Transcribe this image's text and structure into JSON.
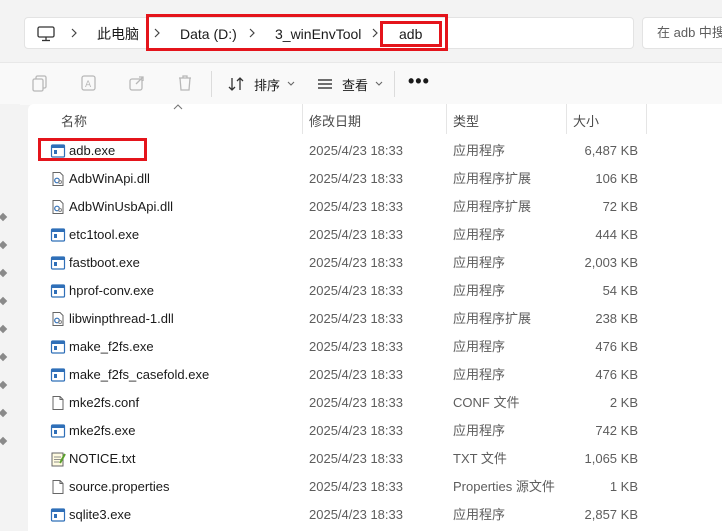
{
  "breadcrumb": {
    "items": [
      "此电脑",
      "Data (D:)",
      "3_winEnvTool",
      "adb"
    ]
  },
  "search": {
    "placeholder": "在 adb 中搜"
  },
  "toolbar": {
    "sort_label": "排序",
    "view_label": "查看",
    "more_label": "•••"
  },
  "columns": {
    "name": "名称",
    "date": "修改日期",
    "type": "类型",
    "size": "大小"
  },
  "highlight_color": "#e4141b",
  "files": [
    {
      "name": "adb.exe",
      "date": "2025/4/23 18:33",
      "type": "应用程序",
      "size": "6,487 KB",
      "icon": "exe-icon"
    },
    {
      "name": "AdbWinApi.dll",
      "date": "2025/4/23 18:33",
      "type": "应用程序扩展",
      "size": "106 KB",
      "icon": "dll-icon"
    },
    {
      "name": "AdbWinUsbApi.dll",
      "date": "2025/4/23 18:33",
      "type": "应用程序扩展",
      "size": "72 KB",
      "icon": "dll-icon"
    },
    {
      "name": "etc1tool.exe",
      "date": "2025/4/23 18:33",
      "type": "应用程序",
      "size": "444 KB",
      "icon": "exe-icon"
    },
    {
      "name": "fastboot.exe",
      "date": "2025/4/23 18:33",
      "type": "应用程序",
      "size": "2,003 KB",
      "icon": "exe-icon"
    },
    {
      "name": "hprof-conv.exe",
      "date": "2025/4/23 18:33",
      "type": "应用程序",
      "size": "54 KB",
      "icon": "exe-icon"
    },
    {
      "name": "libwinpthread-1.dll",
      "date": "2025/4/23 18:33",
      "type": "应用程序扩展",
      "size": "238 KB",
      "icon": "dll-icon"
    },
    {
      "name": "make_f2fs.exe",
      "date": "2025/4/23 18:33",
      "type": "应用程序",
      "size": "476 KB",
      "icon": "exe-icon"
    },
    {
      "name": "make_f2fs_casefold.exe",
      "date": "2025/4/23 18:33",
      "type": "应用程序",
      "size": "476 KB",
      "icon": "exe-icon"
    },
    {
      "name": "mke2fs.conf",
      "date": "2025/4/23 18:33",
      "type": "CONF 文件",
      "size": "2 KB",
      "icon": "file-icon"
    },
    {
      "name": "mke2fs.exe",
      "date": "2025/4/23 18:33",
      "type": "应用程序",
      "size": "742 KB",
      "icon": "exe-icon"
    },
    {
      "name": "NOTICE.txt",
      "date": "2025/4/23 18:33",
      "type": "TXT 文件",
      "size": "1,065 KB",
      "icon": "txt-icon"
    },
    {
      "name": "source.properties",
      "date": "2025/4/23 18:33",
      "type": "Properties 源文件",
      "size": "1 KB",
      "icon": "file-icon"
    },
    {
      "name": "sqlite3.exe",
      "date": "2025/4/23 18:33",
      "type": "应用程序",
      "size": "2,857 KB",
      "icon": "exe-icon"
    }
  ]
}
